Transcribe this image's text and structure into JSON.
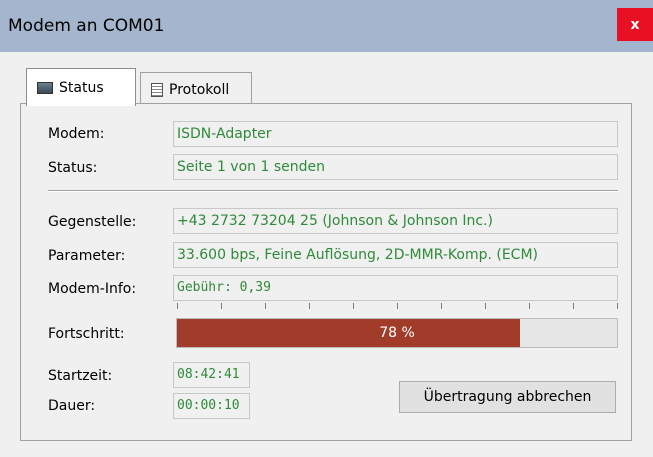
{
  "window": {
    "title": "Modem an COM01",
    "close_glyph": "x",
    "accent": "#a4b6cd",
    "close_bg": "#e81123"
  },
  "tabs": [
    {
      "label": "Status",
      "icon": "monitor-icon",
      "active": true
    },
    {
      "label": "Protokoll",
      "icon": "document-icon",
      "active": false
    }
  ],
  "fields": {
    "modem": {
      "label": "Modem:",
      "value": "ISDN-Adapter"
    },
    "status": {
      "label": "Status:",
      "value": "Seite 1 von 1 senden"
    },
    "gegenstelle": {
      "label": "Gegenstelle:",
      "value": "+43 2732 73204 25 (Johnson & Johnson Inc.)"
    },
    "parameter": {
      "label": "Parameter:",
      "value": "33.600 bps, Feine Auflösung, 2D-MMR-Komp. (ECM)"
    },
    "modem_info": {
      "label": "Modem-Info:",
      "value": "Gebühr: 0,39"
    }
  },
  "progress": {
    "label": "Fortschritt:",
    "percent": 78,
    "text": "78 %",
    "color": "#a23c2a"
  },
  "times": {
    "start_label": "Startzeit:",
    "start_value": "08:42:41",
    "duration_label": "Dauer:",
    "duration_value": "00:00:10"
  },
  "actions": {
    "abort_label": "Übertragung abbrechen"
  },
  "colors": {
    "value_text": "#2f8a39"
  }
}
